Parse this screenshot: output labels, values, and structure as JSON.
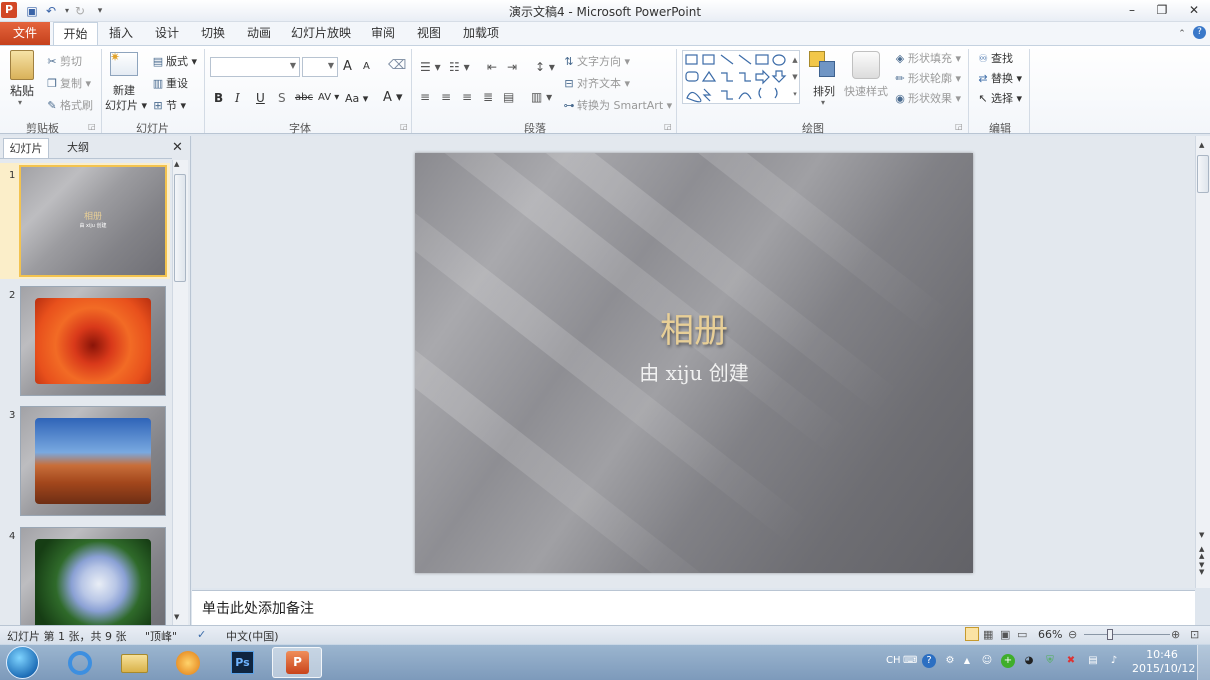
{
  "window": {
    "title": "演示文稿4 - Microsoft PowerPoint",
    "app_logo": "P",
    "minimize": "–",
    "restore": "❐",
    "close": "✕"
  },
  "ribbon": {
    "file_tab": "文件",
    "tabs": [
      "开始",
      "插入",
      "设计",
      "切换",
      "动画",
      "幻灯片放映",
      "审阅",
      "视图",
      "加载项"
    ],
    "clipboard": {
      "paste": "粘贴",
      "cut": "剪切",
      "copy": "复制",
      "format_painter": "格式刷",
      "label": "剪贴板"
    },
    "slides": {
      "new_slide_line1": "新建",
      "new_slide_line2": "幻灯片",
      "layout": "版式",
      "reset": "重设",
      "section": "节",
      "label": "幻灯片"
    },
    "font": {
      "label": "字体",
      "bold": "B",
      "italic": "I",
      "underline": "U",
      "shadow": "S",
      "strike": "abc",
      "spacing": "AV",
      "case": "Aa",
      "color": "A",
      "grow": "A",
      "shrink": "A"
    },
    "paragraph": {
      "text_direction": "文字方向",
      "align_text": "对齐文本",
      "smartart": "转换为 SmartArt",
      "label": "段落"
    },
    "drawing": {
      "arrange": "排列",
      "quick_styles": "快速样式",
      "shape_fill": "形状填充",
      "shape_outline": "形状轮廓",
      "shape_effects": "形状效果",
      "label": "绘图"
    },
    "editing": {
      "find": "查找",
      "replace": "替换",
      "select": "选择",
      "label": "编辑"
    }
  },
  "panel": {
    "tab_slides": "幻灯片",
    "tab_outline": "大纲",
    "close": "✕",
    "slide_numbers": [
      "1",
      "2",
      "3",
      "4"
    ],
    "thumb1_title": "相册",
    "thumb1_subtitle": "由 xiju 创建"
  },
  "slide": {
    "title": "相册",
    "subtitle": "由 xiju 创建"
  },
  "notes": {
    "placeholder": "单击此处添加备注"
  },
  "status": {
    "slide_info": "幻灯片 第 1 张，共 9 张",
    "theme": "\"顶峰\"",
    "language": "中文(中国)",
    "zoom": "66%"
  },
  "taskbar": {
    "ime": "CH",
    "clock_time": "10:46",
    "clock_date": "2015/10/12"
  }
}
